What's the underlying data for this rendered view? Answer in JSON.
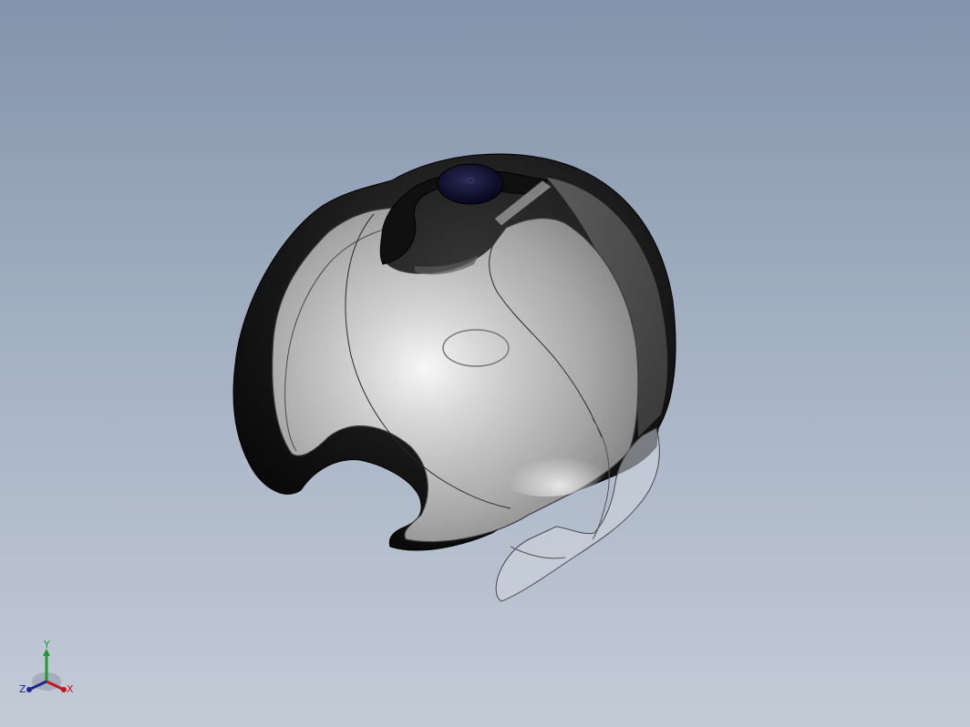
{
  "viewport": {
    "background_top": "#8393ab",
    "background_bottom": "#c3cbd6"
  },
  "model": {
    "shell_color": "#0f0f0f",
    "insert_color": "#b8b8b8",
    "knob_color": "#0b0b2a",
    "clip_color": "#c9cfd8"
  },
  "triad": {
    "x_label": "X",
    "y_label": "Y",
    "z_label": "Z",
    "x_color": "#c8141e",
    "y_color": "#1e9a28",
    "z_color": "#1e2890"
  }
}
